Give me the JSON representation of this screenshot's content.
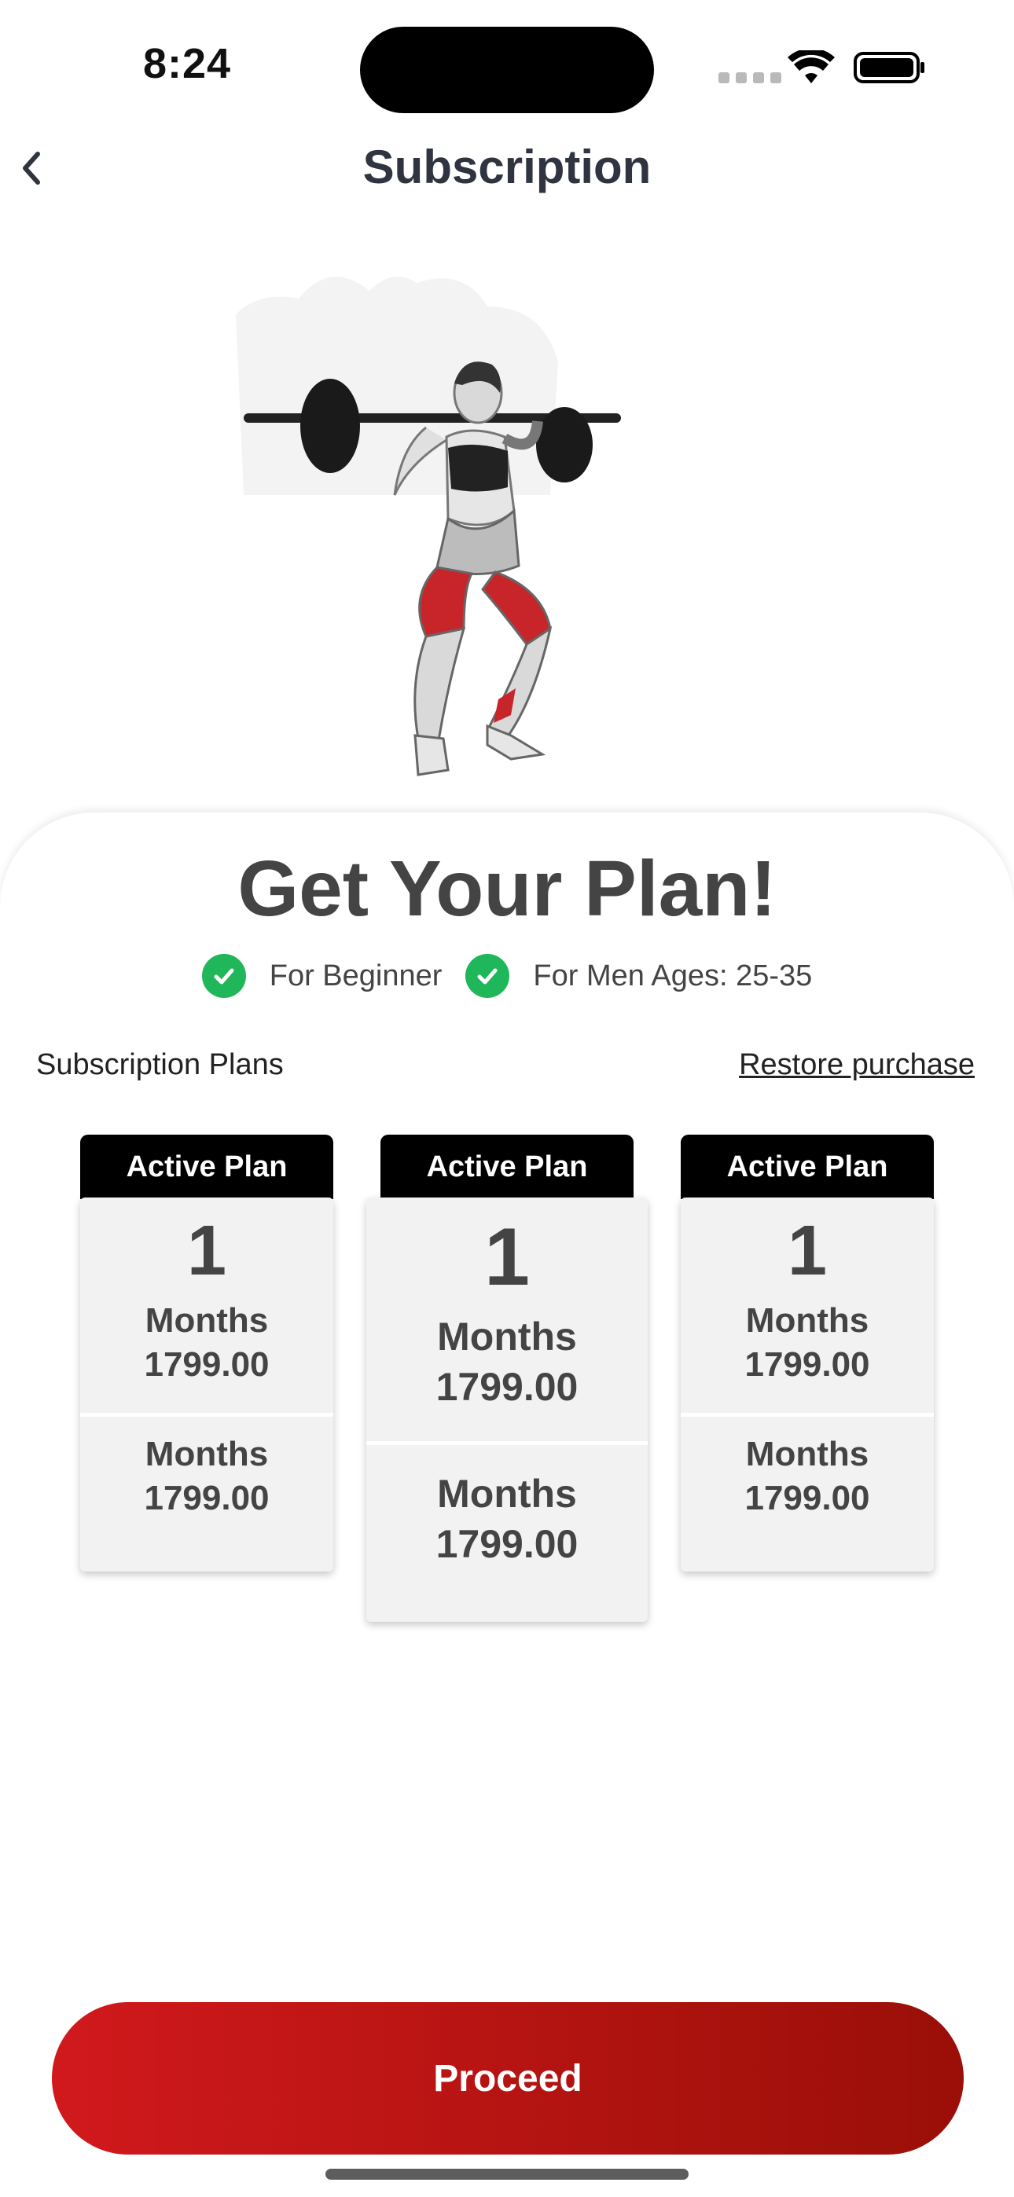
{
  "status_bar": {
    "time": "8:24"
  },
  "header": {
    "title": "Subscription"
  },
  "hero": {
    "image": "woman-barbell-squat-illustration"
  },
  "card": {
    "headline": "Get Your Plan!",
    "badges": [
      {
        "label": "For Beginner"
      },
      {
        "label": "For Men Ages: 25-35"
      }
    ],
    "section_label": "Subscription Plans",
    "restore_label": "Restore purchase"
  },
  "plans": [
    {
      "tag": "Active Plan",
      "count": "1",
      "unit": "Months",
      "price": "1799.00",
      "unit2": "Months",
      "price2": "1799.00"
    },
    {
      "tag": "Active Plan",
      "count": "1",
      "unit": "Months",
      "price": "1799.00",
      "unit2": "Months",
      "price2": "1799.00"
    },
    {
      "tag": "Active Plan",
      "count": "1",
      "unit": "Months",
      "price": "1799.00",
      "unit2": "Months",
      "price2": "1799.00"
    }
  ],
  "cta": {
    "label": "Proceed"
  },
  "colors": {
    "accent_red_start": "#d1191c",
    "accent_red_end": "#9a0f08",
    "check_green": "#20b65a"
  }
}
